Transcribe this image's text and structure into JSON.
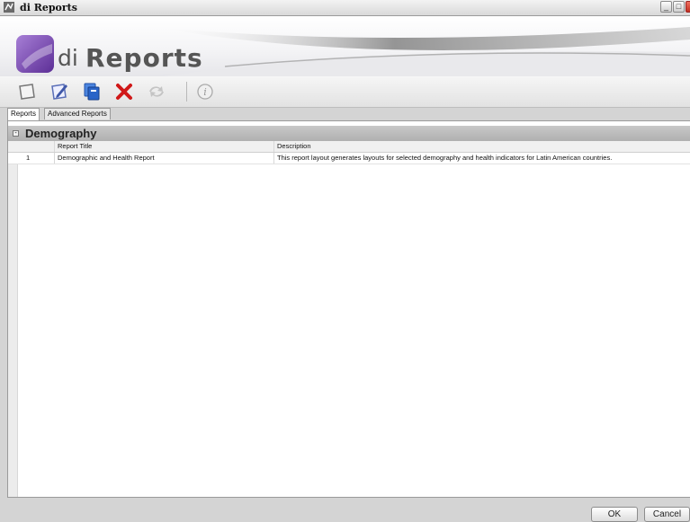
{
  "window": {
    "title": "di Reports",
    "controls": {
      "minimize": "_",
      "maximize": "□"
    }
  },
  "banner": {
    "logo_prefix": "di",
    "logo_word": "Reports"
  },
  "toolbar": {
    "icons": [
      "new-report-icon",
      "edit-report-icon",
      "copy-report-icon",
      "delete-report-icon",
      "refresh-icon",
      "info-icon"
    ],
    "separator_after": "refresh-icon"
  },
  "tabs": [
    {
      "label": "Reports",
      "active": true
    },
    {
      "label": "Advanced Reports",
      "active": false
    }
  ],
  "group": {
    "collapse_symbol": "-",
    "title": "Demography"
  },
  "grid": {
    "columns": [
      "",
      "Report Title",
      "Description"
    ],
    "rows": [
      {
        "num": "1",
        "title": "Demographic and Health Report",
        "description": "This report layout generates layouts for selected demography and health indicators for Latin American countries."
      }
    ]
  },
  "footer": {
    "ok_label": "OK",
    "cancel_label": "Cancel"
  },
  "colors": {
    "accent": "#7b4fb0",
    "delete": "#d01818",
    "copy": "#2a64c8",
    "edit": "#5a6fb8"
  }
}
